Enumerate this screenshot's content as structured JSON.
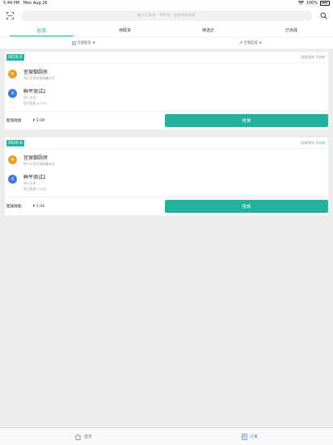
{
  "status": {
    "time": "5:44 PM",
    "date": "Mon Aug 26",
    "battery": "100%"
  },
  "search": {
    "placeholder": "输入订单号、手机号、收货地址搜索"
  },
  "tabs": [
    {
      "label": "抢单",
      "active": true
    },
    {
      "label": "待取货",
      "active": false
    },
    {
      "label": "待送达",
      "active": false
    },
    {
      "label": "已完成",
      "active": false
    }
  ],
  "filters": {
    "left": "全部配送",
    "right": "全部区域"
  },
  "orders": [
    {
      "id": "0826-5",
      "wait_label": "顾客等待",
      "wait_mins": "5分钟",
      "pickup": {
        "badge": "取",
        "name": "宫保御厨房",
        "address": "四川大学后街新鑫村号"
      },
      "dropoff": {
        "badge": "送",
        "name": "鲜平测试2",
        "line1": "四川大学",
        "line2": "男生宿舍-5-309"
      },
      "earn_label": "配送收益",
      "earn_value": "¥ 1.09",
      "button": "抢单"
    },
    {
      "id": "0826-6",
      "wait_label": "顾客等待",
      "wait_mins": "4分钟",
      "pickup": {
        "badge": "取",
        "name": "宫保御厨房",
        "address": "四川大学后街新鑫村号"
      },
      "dropoff": {
        "badge": "送",
        "name": "鲜平测试2",
        "line1": "四川大学",
        "line2": "男生宿舍-5-309"
      },
      "earn_label": "配送收益",
      "earn_value": "¥ 1.04",
      "button": "抢单"
    }
  ],
  "nav": [
    {
      "label": "首页",
      "icon": "home-icon"
    },
    {
      "label": "订单",
      "icon": "order-icon",
      "active": true
    }
  ],
  "colors": {
    "accent": "#27b39b",
    "pickup_badge": "#e9a02a",
    "dropoff_badge": "#3f7ad6",
    "nav_active": "#3f7ad6"
  }
}
